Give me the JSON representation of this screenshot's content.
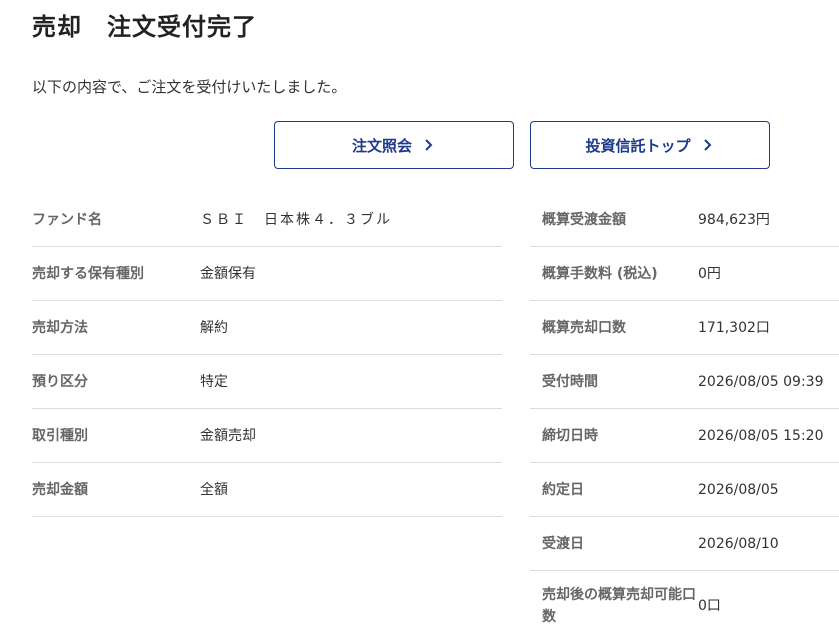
{
  "header": {
    "title": "売却　注文受付完了",
    "message": "以下の内容で、ご注文を受付けいたしました。"
  },
  "buttons": {
    "order_inquiry": "注文照会",
    "fund_top": "投資信託トップ"
  },
  "order_details": [
    {
      "label": "ファンド名",
      "value": "ＳＢＩ　日本株４．３ブル"
    },
    {
      "label": "売却する保有種別",
      "value": "金額保有"
    },
    {
      "label": "売却方法",
      "value": "解約"
    },
    {
      "label": "預り区分",
      "value": "特定"
    },
    {
      "label": "取引種別",
      "value": "金額売却"
    },
    {
      "label": "売却金額",
      "value": "全額"
    }
  ],
  "summary": [
    {
      "label": "概算受渡金額",
      "value": "984,623円"
    },
    {
      "label": "概算手数料 (税込)",
      "value": "0円"
    },
    {
      "label": "概算売却口数",
      "value": "171,302口"
    },
    {
      "label": "受付時間",
      "value": "2026/08/05 09:39"
    },
    {
      "label": "締切日時",
      "value": "2026/08/05 15:20"
    },
    {
      "label": "約定日",
      "value": "2026/08/05"
    },
    {
      "label": "受渡日",
      "value": "2026/08/10"
    },
    {
      "label": "売却後の概算売却可能口数",
      "value": "0口"
    }
  ],
  "colors": {
    "accent": "#1e3a8a",
    "label": "#666666",
    "divider": "#dddddd"
  },
  "icons": {
    "button_arrow": "chevron-right-icon"
  }
}
